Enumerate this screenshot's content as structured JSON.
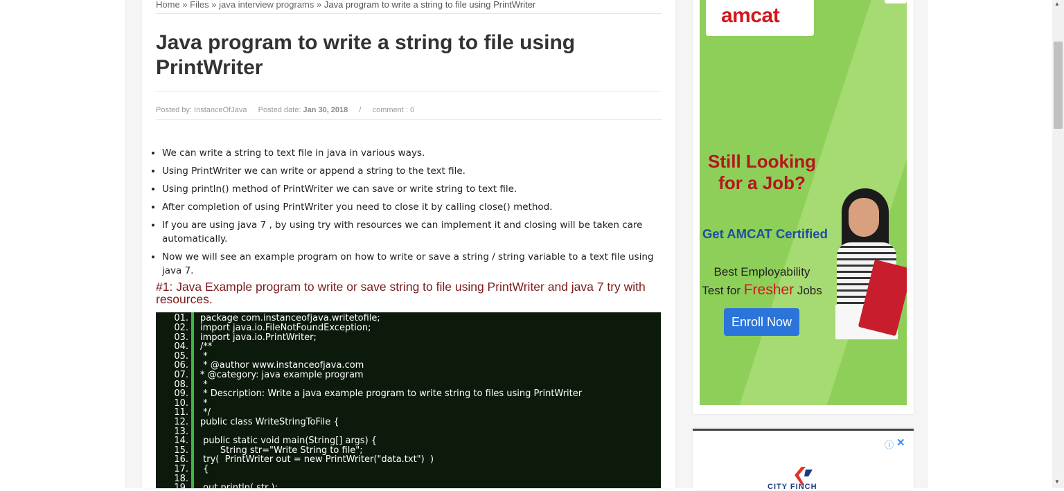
{
  "breadcrumb": {
    "home": "Home",
    "sep": "»",
    "files": "Files",
    "category": "java interview programs",
    "current": "Java program to write a string to file using PrintWriter"
  },
  "post": {
    "title": "Java program to write a string to file using PrintWriter",
    "meta": {
      "posted_by_label": "Posted by:",
      "author": "InstanceOfJava",
      "posted_date_label": "Posted date:",
      "date": "Jan 30, 2018",
      "divider": "/",
      "comments": "comment : 0"
    },
    "bullets": [
      "We can write a string to text file in java in various ways.",
      "Using PrintWriter we can write or append a string to the text file.",
      "Using println() method of PrintWriter we can save or write string to text file.",
      "After completion of using PrintWriter you need to close it by calling close() method.",
      "If you are using java 7 , by using try with resources we can implement it and closing will be taken care automatically.",
      "Now we will see an example program on how to write or save a string / string variable  to a text file using java 7."
    ],
    "subheading": "#1: Java Example program to write or save string to file using PrintWriter and java 7 try with resources.",
    "code": [
      {
        "n": "01.",
        "t": "package com.instanceofjava.writetofile;"
      },
      {
        "n": "02.",
        "t": "import java.io.FileNotFoundException;"
      },
      {
        "n": "03.",
        "t": "import java.io.PrintWriter;"
      },
      {
        "n": "04.",
        "t": "/**"
      },
      {
        "n": "05.",
        "t": " *"
      },
      {
        "n": "06.",
        "t": " * @author www.instanceofjava.com"
      },
      {
        "n": "07.",
        "t": "* @category: java example program"
      },
      {
        "n": "08.",
        "t": " *"
      },
      {
        "n": "09.",
        "t": " * Description: Write a java example program to write string to files using PrintWriter"
      },
      {
        "n": "10.",
        "t": " *"
      },
      {
        "n": "11.",
        "t": " */"
      },
      {
        "n": "12.",
        "t": "public class WriteStringToFile {"
      },
      {
        "n": "13.",
        "t": ""
      },
      {
        "n": "14.",
        "t": " public static void main(String[] args) {"
      },
      {
        "n": "15.",
        "t": "       String str=\"Write String to file\";"
      },
      {
        "n": "16.",
        "t": " try(  PrintWriter out = new PrintWriter(\"data.txt\")  )"
      },
      {
        "n": "17.",
        "t": " {"
      },
      {
        "n": "18.",
        "t": ""
      },
      {
        "n": "19.",
        "t": " out.println( str );"
      }
    ]
  },
  "sidebar": {
    "ad1": {
      "logo": "amcat",
      "headline": "Still Looking for a Job?",
      "cert": "Get AMCAT Certified",
      "best_line1": "Best Employability",
      "best_line2_prefix": "Test for ",
      "best_line2_highlight": "Fresher",
      "best_line2_suffix": " Jobs",
      "cta": "Enroll Now"
    },
    "ad2": {
      "info_icon": "ⓘ",
      "close_icon": "✕",
      "brand_text": "CITY FINCH"
    }
  },
  "colors": {
    "title": "#333333",
    "subheading": "#7a1a1a",
    "code_bg": "#0c1a0c",
    "code_gutter": "#3fb63f",
    "ad_green": "#8ecf5a",
    "ad_red": "#b3171c",
    "ad_blue": "#2b74d9"
  }
}
